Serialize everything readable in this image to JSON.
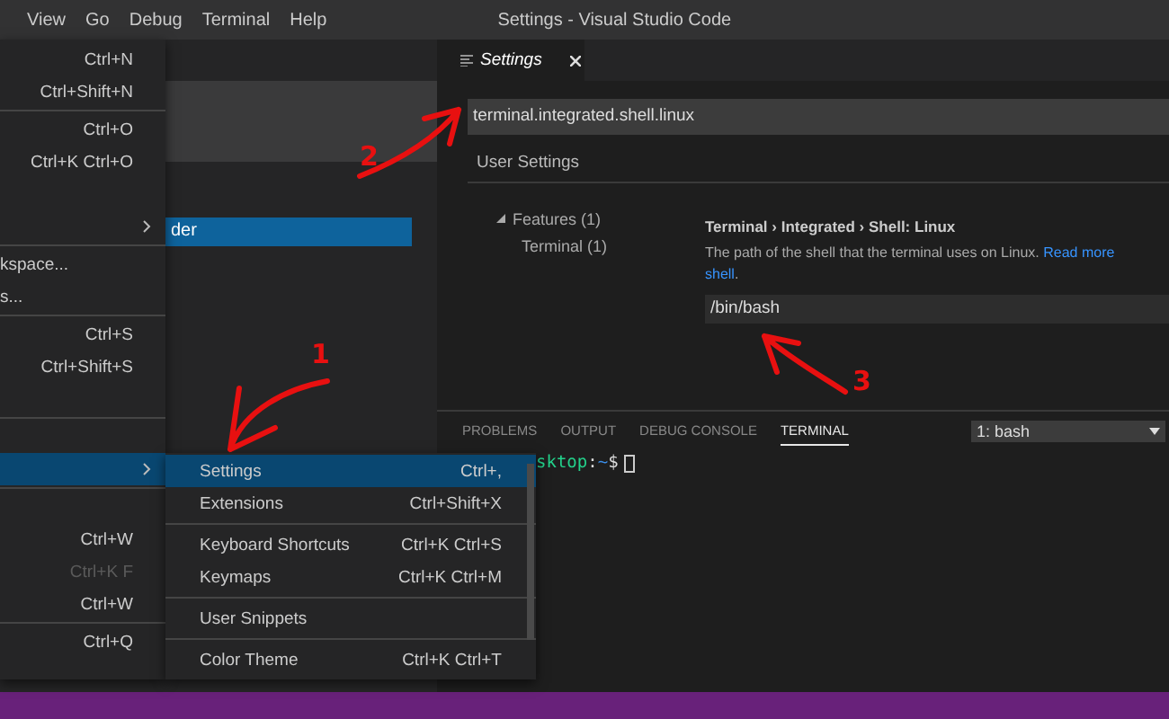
{
  "menu_bar": {
    "items": [
      "View",
      "Go",
      "Debug",
      "Terminal",
      "Help"
    ]
  },
  "window": {
    "title": "Settings - Visual Studio Code"
  },
  "file_menu": {
    "items": [
      {
        "kind": "item",
        "shortcut": "Ctrl+N",
        "disabled": false,
        "selected": false
      },
      {
        "kind": "item",
        "shortcut": "Ctrl+Shift+N",
        "disabled": false,
        "selected": false
      },
      {
        "kind": "separator"
      },
      {
        "kind": "item",
        "shortcut": "Ctrl+O",
        "disabled": false,
        "selected": false
      },
      {
        "kind": "item",
        "shortcut": "Ctrl+K Ctrl+O",
        "disabled": false,
        "selected": false
      },
      {
        "kind": "blank"
      },
      {
        "kind": "submenu",
        "selected": false
      },
      {
        "kind": "separator"
      },
      {
        "kind": "item",
        "label": "kspace...",
        "disabled": false,
        "selected": false
      },
      {
        "kind": "item",
        "label": "s...",
        "disabled": false,
        "selected": false
      },
      {
        "kind": "separator"
      },
      {
        "kind": "item",
        "shortcut": "Ctrl+S",
        "disabled": false,
        "selected": false
      },
      {
        "kind": "item",
        "shortcut": "Ctrl+Shift+S",
        "disabled": false,
        "selected": false
      },
      {
        "kind": "blank"
      },
      {
        "kind": "separator"
      },
      {
        "kind": "blank"
      },
      {
        "kind": "submenu",
        "selected": true
      },
      {
        "kind": "separator"
      },
      {
        "kind": "blank"
      },
      {
        "kind": "item",
        "shortcut": "Ctrl+W",
        "disabled": false,
        "selected": false
      },
      {
        "kind": "item",
        "shortcut": "Ctrl+K F",
        "disabled": true,
        "selected": false
      },
      {
        "kind": "item",
        "shortcut": "Ctrl+W",
        "disabled": false,
        "selected": false
      },
      {
        "kind": "separator"
      },
      {
        "kind": "item",
        "shortcut": "Ctrl+Q",
        "disabled": false,
        "selected": false
      }
    ]
  },
  "preferences_menu": {
    "items": [
      {
        "kind": "item",
        "label": "Settings",
        "shortcut": "Ctrl+,",
        "selected": true
      },
      {
        "kind": "item",
        "label": "Extensions",
        "shortcut": "Ctrl+Shift+X",
        "selected": false
      },
      {
        "kind": "separator"
      },
      {
        "kind": "item",
        "label": "Keyboard Shortcuts",
        "shortcut": "Ctrl+K Ctrl+S",
        "selected": false
      },
      {
        "kind": "item",
        "label": "Keymaps",
        "shortcut": "Ctrl+K Ctrl+M",
        "selected": false
      },
      {
        "kind": "separator"
      },
      {
        "kind": "item",
        "label": "User Snippets",
        "selected": false
      },
      {
        "kind": "separator"
      },
      {
        "kind": "item",
        "label": "Color Theme",
        "shortcut": "Ctrl+K Ctrl+T",
        "selected": false
      }
    ]
  },
  "sidebar": {
    "item": {
      "label": "der",
      "selected": true
    }
  },
  "editor_tabs": [
    {
      "label": "Settings",
      "selected": true
    }
  ],
  "settings": {
    "search": {
      "value": "terminal.integrated.shell.linux"
    },
    "section": "User Settings",
    "tree": [
      {
        "label": "Features (1)",
        "expanded": true,
        "children": [
          {
            "label": "Terminal (1)"
          }
        ]
      }
    ],
    "setting": {
      "title": "Terminal › Integrated › Shell: Linux",
      "description": "The path of the shell that the terminal uses on Linux.",
      "link": "Read more",
      "link_2": "shell",
      "suffix": ".",
      "value": "/bin/bash"
    }
  },
  "panel": {
    "tabs": [
      {
        "label": "PROBLEMS",
        "selected": false
      },
      {
        "label": "OUTPUT",
        "selected": false
      },
      {
        "label": "DEBUG CONSOLE",
        "selected": false
      },
      {
        "label": "TERMINAL",
        "selected": true
      }
    ],
    "terminal_select": "1: bash",
    "prompt": [
      {
        "kind": "host",
        "text": "sktop"
      },
      {
        "kind": "plain",
        "text": ":"
      },
      {
        "kind": "path",
        "text": "~"
      },
      {
        "kind": "plain",
        "text": "$"
      }
    ]
  },
  "annotations": [
    {
      "number": "1"
    },
    {
      "number": "2"
    },
    {
      "number": "3"
    }
  ]
}
